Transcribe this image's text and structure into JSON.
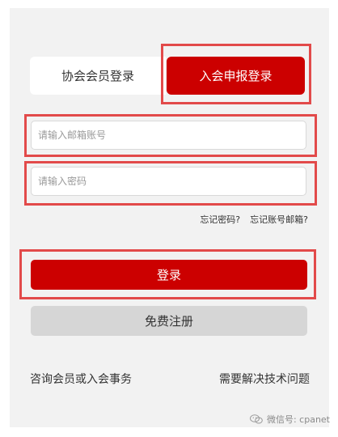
{
  "tabs": {
    "member_login": "协会会员登录",
    "apply_login": "入会申报登录"
  },
  "form": {
    "email_placeholder": "请输入邮箱账号",
    "password_placeholder": "请输入密码",
    "forgot_password": "忘记密码?",
    "forgot_account": "忘记账号邮箱?"
  },
  "buttons": {
    "login": "登录",
    "register": "免费注册"
  },
  "links": {
    "consult": "咨询会员或入会事务",
    "tech_support": "需要解决技术问题"
  },
  "watermark": {
    "text": "微信号: cpanet",
    "icon": "wechat-icon"
  },
  "colors": {
    "accent": "#cc0000",
    "highlight": "#e24a4a",
    "background": "#f2f2f2"
  }
}
